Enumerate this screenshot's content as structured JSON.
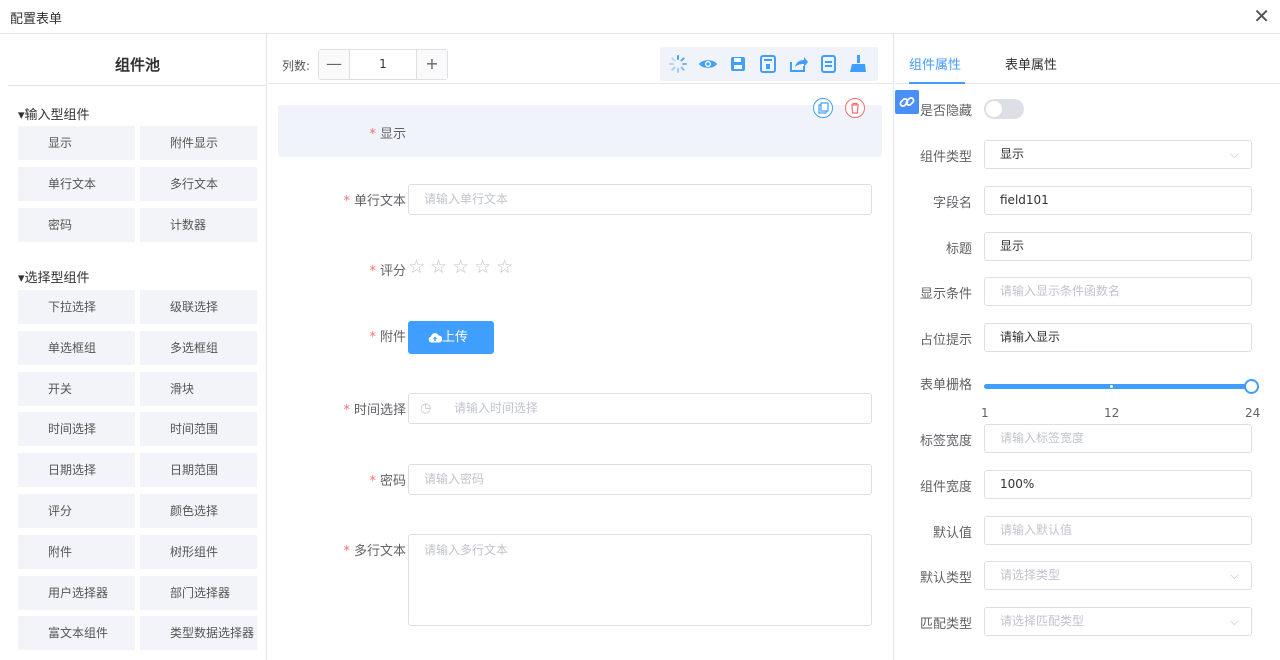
{
  "window": {
    "title": "配置表单"
  },
  "palette": {
    "title": "组件池",
    "groups": [
      {
        "title": "▾输入型组件",
        "items": [
          "显示",
          "附件显示",
          "单行文本",
          "多行文本",
          "密码",
          "计数器"
        ]
      },
      {
        "title": "▾选择型组件",
        "items": [
          "下拉选择",
          "级联选择",
          "单选框组",
          "多选框组",
          "开关",
          "滑块",
          "时间选择",
          "时间范围",
          "日期选择",
          "日期范围",
          "评分",
          "颜色选择",
          "附件",
          "树形组件",
          "用户选择器",
          "部门选择器",
          "富文本组件",
          "类型数据选择器"
        ]
      }
    ]
  },
  "toolbar": {
    "cols_label": "列数:",
    "cols_value": "1",
    "minus": "—",
    "plus": "+",
    "icons": [
      "loading-icon",
      "eye-icon",
      "save-icon",
      "template-icon",
      "share-icon",
      "copy-list-icon",
      "broom-icon"
    ]
  },
  "form": {
    "fields": [
      {
        "label": "显示",
        "required": "*"
      },
      {
        "label": "单行文本",
        "required": "*",
        "placeholder": "请输入单行文本"
      },
      {
        "label": "评分",
        "required": "*",
        "stars": "☆☆☆☆☆"
      },
      {
        "label": "附件",
        "required": "*",
        "button": "上传"
      },
      {
        "label": "时间选择",
        "required": "*",
        "placeholder": "请输入时间选择"
      },
      {
        "label": "密码",
        "required": "*",
        "placeholder": "请输入密码"
      },
      {
        "label": "多行文本",
        "required": "*",
        "placeholder": "请输入多行文本"
      }
    ]
  },
  "props": {
    "tabs": [
      "组件属性",
      "表单属性"
    ],
    "hidden_label": "是否隐藏",
    "rows": [
      {
        "label": "组件类型",
        "value": "显示",
        "select": true,
        "filled": true
      },
      {
        "label": "字段名",
        "value": "field101",
        "filled": true
      },
      {
        "label": "标题",
        "value": "显示",
        "filled": true
      },
      {
        "label": "显示条件",
        "value": "请输入显示条件函数名"
      },
      {
        "label": "占位提示",
        "value": "请输入显示",
        "filled": true
      }
    ],
    "grid_label": "表单栅格",
    "grid": {
      "min": "1",
      "mid": "12",
      "max": "24",
      "value": 24
    },
    "rows2": [
      {
        "label": "标签宽度",
        "value": "请输入标签宽度"
      },
      {
        "label": "组件宽度",
        "value": "100%",
        "filled": true
      },
      {
        "label": "默认值",
        "value": "请输入默认值"
      },
      {
        "label": "默认类型",
        "value": "请选择类型",
        "select": true
      },
      {
        "label": "匹配类型",
        "value": "请选择匹配类型",
        "select": true
      }
    ],
    "arrow": "⌵"
  },
  "colors": {
    "primary": "#409eff",
    "required": "#f56c6c"
  }
}
